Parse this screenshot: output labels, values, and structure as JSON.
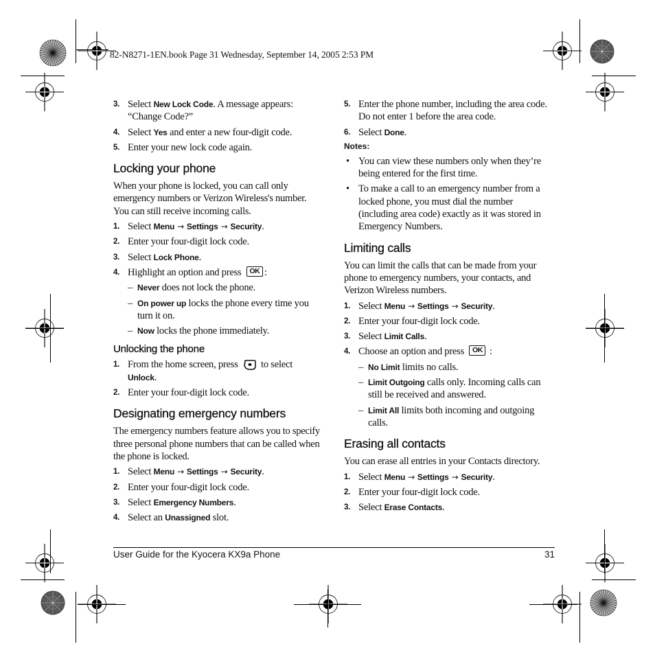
{
  "slug": "82-N8271-1EN.book  Page 31  Wednesday, September 14, 2005  2:53 PM",
  "left_column": {
    "steps_top": [
      {
        "num": "3.",
        "pre": "Select ",
        "ui": "New Lock Code",
        "post": ". A message appears: “Change Code?”"
      },
      {
        "num": "4.",
        "pre": "Select ",
        "ui": "Yes",
        "post": " and enter a new four-digit code."
      },
      {
        "num": "5.",
        "pre": "Enter your new lock code again.",
        "ui": "",
        "post": ""
      }
    ],
    "locking": {
      "heading": "Locking your phone",
      "intro": "When your phone is locked, you can call only emergency numbers or Verizon Wireless's number. You can still receive incoming calls.",
      "step1": {
        "num": "1.",
        "pre": "Select ",
        "menu": "Menu",
        "arrow": "→",
        "settings": "Settings",
        "security": "Security",
        "post": "."
      },
      "step2": {
        "num": "2.",
        "text": "Enter your four-digit lock code."
      },
      "step3": {
        "num": "3.",
        "pre": "Select ",
        "ui": "Lock Phone",
        "post": "."
      },
      "step4": {
        "num": "4.",
        "pre": "Highlight an option and press",
        "key": "OK",
        "post": ":"
      },
      "options": [
        {
          "dash": "–",
          "ui": "Never",
          "text": " does not lock the phone."
        },
        {
          "dash": "–",
          "ui": "On power up",
          "text": " locks the phone every time you turn it on."
        },
        {
          "dash": "–",
          "ui": "Now",
          "text": " locks the phone immediately."
        }
      ]
    },
    "unlocking": {
      "heading": "Unlocking the phone",
      "step1": {
        "num": "1.",
        "pre": "From the home screen, press",
        "post": "to select ",
        "ui": "Unlock",
        "end": "."
      },
      "step2": {
        "num": "2.",
        "text": "Enter your four-digit lock code."
      }
    },
    "emergency": {
      "heading": "Designating emergency numbers",
      "intro": "The emergency numbers feature allows you to specify three personal phone numbers that can be called when the phone is locked.",
      "step1": {
        "num": "1.",
        "pre": "Select ",
        "menu": "Menu",
        "arrow": "→",
        "settings": "Settings",
        "security": "Security",
        "post": "."
      },
      "step2": {
        "num": "2.",
        "text": "Enter your four-digit lock code."
      },
      "step3": {
        "num": "3.",
        "pre": "Select ",
        "ui": "Emergency Numbers",
        "post": "."
      },
      "step4": {
        "num": "4.",
        "pre": "Select an ",
        "ui": "Unassigned",
        "post": " slot."
      }
    }
  },
  "right_column": {
    "step5": {
      "num": "5.",
      "text": "Enter the phone number, including the area code. Do not enter 1 before the area code."
    },
    "step6": {
      "num": "6.",
      "pre": "Select ",
      "ui": "Done",
      "post": "."
    },
    "notes_label": "Notes:",
    "notes": [
      {
        "dot": "•",
        "text": "You can view these numbers only when they’re being entered for the first time."
      },
      {
        "dot": "•",
        "text": "To make a call to an emergency number from a locked phone, you must dial the number (including area code) exactly as it was stored in Emergency Numbers."
      }
    ],
    "limiting": {
      "heading": "Limiting calls",
      "intro": "You can limit the calls that can be made from your phone to emergency numbers, your contacts, and Verizon Wireless numbers.",
      "step1": {
        "num": "1.",
        "pre": "Select ",
        "menu": "Menu",
        "arrow": "→",
        "settings": "Settings",
        "security": "Security",
        "post": "."
      },
      "step2": {
        "num": "2.",
        "text": "Enter your four-digit lock code."
      },
      "step3": {
        "num": "3.",
        "pre": "Select ",
        "ui": "Limit Calls",
        "post": "."
      },
      "step4": {
        "num": "4.",
        "pre": "Choose an option and press",
        "key": "OK",
        "post": ":"
      },
      "options": [
        {
          "dash": "–",
          "ui": "No Limit",
          "text": " limits no calls."
        },
        {
          "dash": "–",
          "ui": "Limit Outgoing",
          "text": " calls only. Incoming calls can still be received and answered."
        },
        {
          "dash": "–",
          "ui": "Limit All",
          "text": " limits both incoming and outgoing calls."
        }
      ]
    },
    "erasing": {
      "heading": "Erasing all contacts",
      "intro": "You can erase all entries in your Contacts directory.",
      "step1": {
        "num": "1.",
        "pre": "Select ",
        "menu": "Menu",
        "arrow": "→",
        "settings": "Settings",
        "security": "Security",
        "post": "."
      },
      "step2": {
        "num": "2.",
        "text": "Enter your four-digit lock code."
      },
      "step3": {
        "num": "3.",
        "pre": "Select ",
        "ui": "Erase Contacts",
        "post": "."
      }
    }
  },
  "footer": {
    "title": "User Guide for the Kyocera KX9a Phone",
    "page_number": "31"
  },
  "icons": {
    "ok_key": "ok-key-icon",
    "left_softkey": "left-softkey-icon",
    "registration_mark": "registration-crosshair-icon",
    "color_bar_wheel": "star-target-icon"
  }
}
